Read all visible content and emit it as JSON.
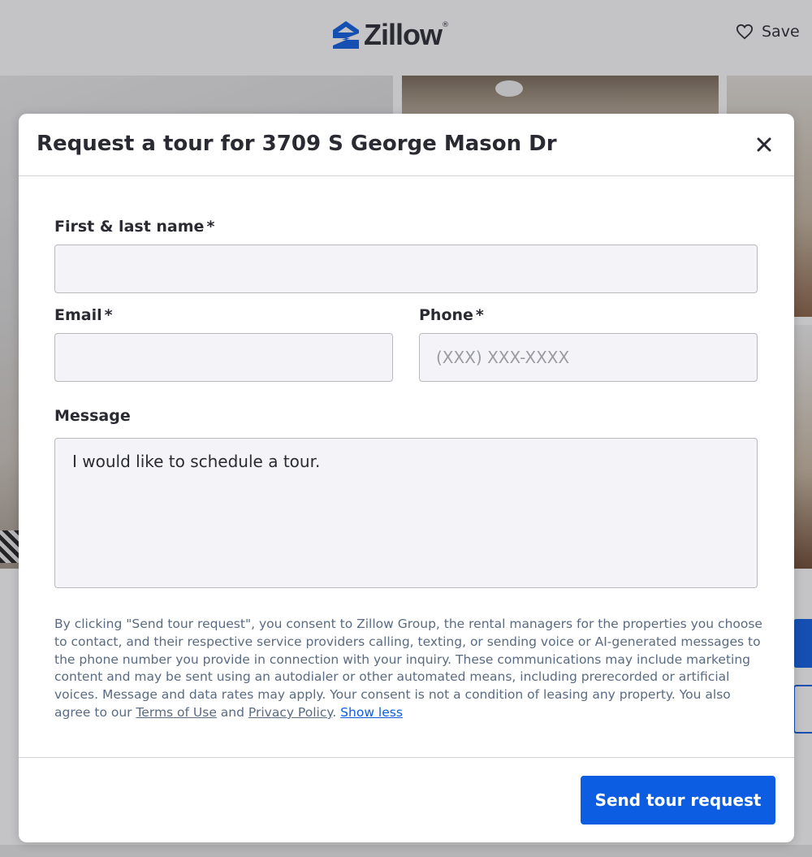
{
  "header": {
    "brand": "Zillow",
    "brand_mark": "®",
    "save_label": "Save"
  },
  "modal": {
    "title": "Request a tour for 3709 S George Mason Dr",
    "name_label": "First & last name",
    "email_label": "Email",
    "phone_label": "Phone",
    "required_mark": "*",
    "name_value": "",
    "email_value": "",
    "phone_placeholder": "(XXX) XXX-XXXX",
    "message_label": "Message",
    "message_value": "I would like to schedule a tour.",
    "consent_text": "By clicking \"Send tour request\", you consent to Zillow Group, the rental managers for the properties you choose to contact, and their respective service providers calling, texting, or sending voice or AI-generated messages to the phone number you provide in connection with your inquiry. These communications may include marketing content and may be sent using an autodialer or other automated means, including prerecorded or artificial voices. Message and data rates may apply. Your consent is not a condition of leasing any property. You also agree to our ",
    "terms_link": "Terms of Use",
    "and_text": " and ",
    "privacy_link": "Privacy Policy",
    "period": ". ",
    "show_less_link": "Show less",
    "send_button": "Send tour request"
  },
  "icons": {
    "close": "close-icon",
    "save": "heart-icon",
    "logo": "zillow-logo-icon"
  },
  "colors": {
    "primary": "#0d5de2",
    "text": "#2a2a33",
    "muted": "#596b82"
  }
}
